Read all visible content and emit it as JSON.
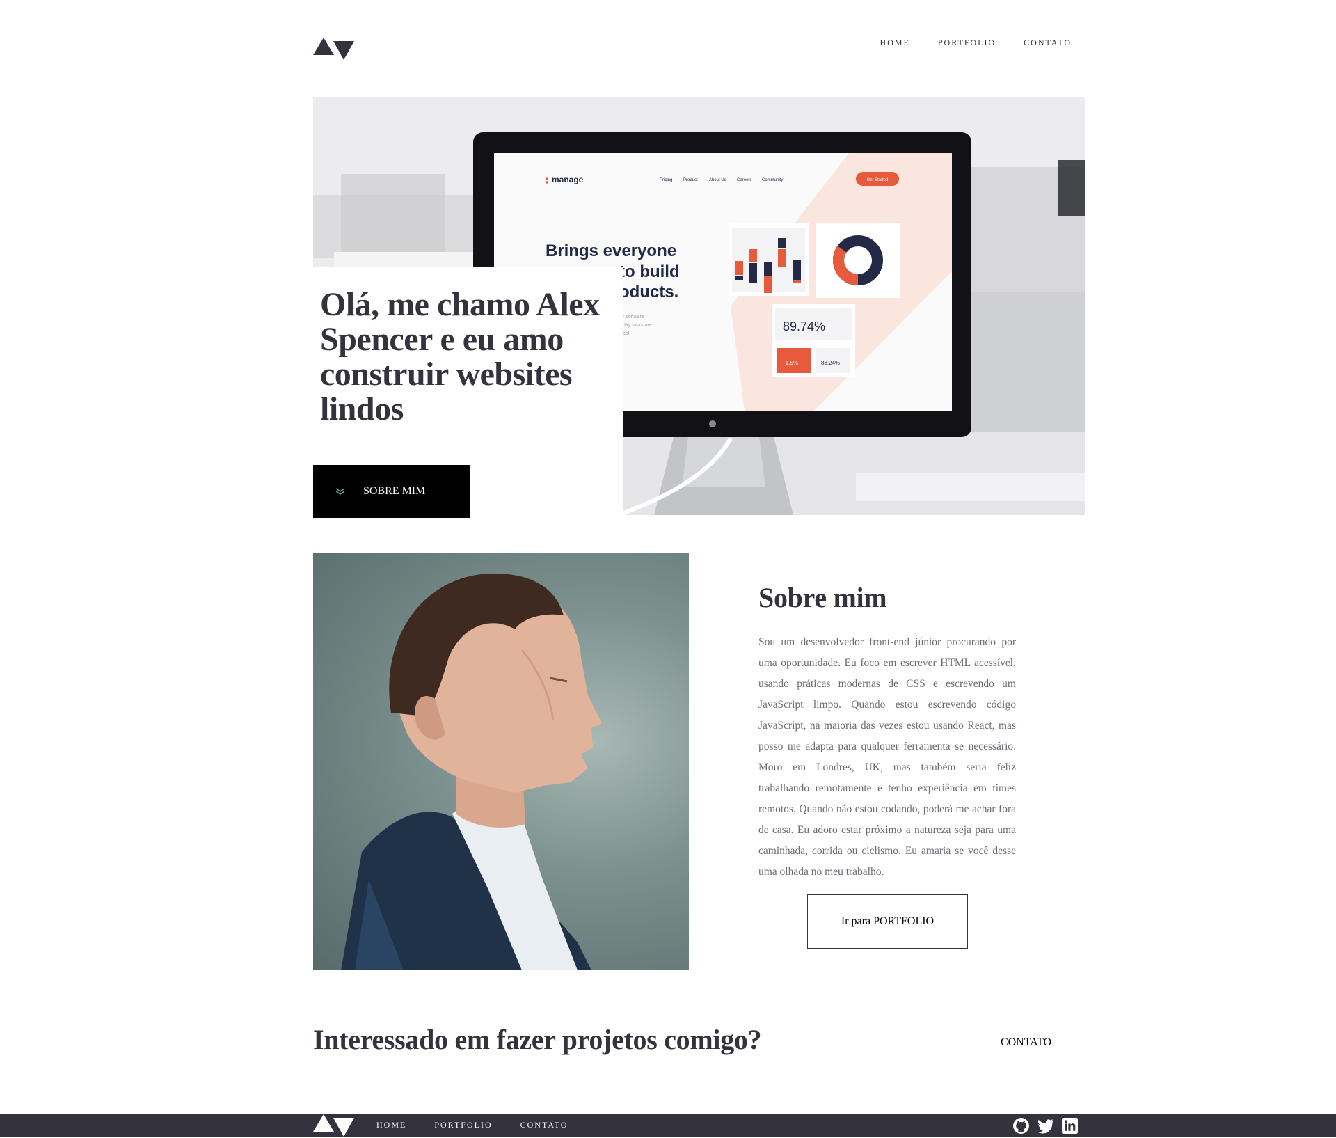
{
  "header": {
    "logo": "logo",
    "nav": [
      "HOME",
      "PORTFOLIO",
      "CONTATO"
    ]
  },
  "hero": {
    "title": "Olá, me chamo Alex Spencer e eu amo construir websites lindos",
    "button_label": "SOBRE MIM",
    "screen": {
      "brand": "manage",
      "menu": [
        "Pricing",
        "Product",
        "About Us",
        "Careers",
        "Community"
      ],
      "cta": "Get Started",
      "headline_line1": "Brings everyone",
      "headline_line2": "to build",
      "headline_line3": "oducts.",
      "stat_main": "89.74%",
      "stat_a": "+1.5%",
      "stat_b": "88.24%",
      "sub1": "r software",
      "sub2": "day tasks are",
      "sub3": "ool."
    }
  },
  "about": {
    "title": "Sobre mim",
    "body": "Sou um desenvolvedor front-end júnior procurando por uma oportunidade. Eu foco em escrever HTML acessível, usando práticas modernas de CSS e escrevendo um JavaScript limpo. Quando estou escrevendo código JavaScript, na maioria das vezes estou usando React, mas posso me adapta para qualquer ferramenta se necessário. Moro em Londres, UK, mas também seria feliz trabalhando remotamente e tenho experiência em times remotos. Quando não estou codando, poderá me achar fora de casa. Eu adoro estar próximo a natureza seja para uma caminhada, corrida ou ciclismo. Eu amaria se você desse uma olhada no meu trabalho.",
    "button_label": "Ir para PORTFOLIO"
  },
  "cta": {
    "title": "Interessado em fazer projetos comigo?",
    "button_label": "CONTATO"
  },
  "footer": {
    "nav": [
      "HOME",
      "PORTFOLIO",
      "CONTATO"
    ],
    "social": [
      "github-icon",
      "twitter-icon",
      "linkedin-icon"
    ]
  },
  "colors": {
    "primary": "#33323d",
    "accent": "#5fb4a2",
    "body_text": "#6b6a75",
    "background": "#ffffff"
  }
}
